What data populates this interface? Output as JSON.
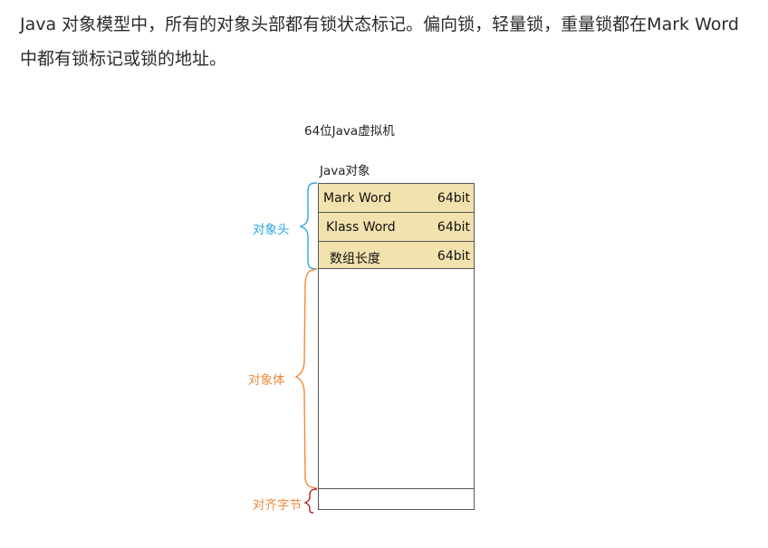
{
  "intro_text": "Java 对象模型中，所有的对象头部都有锁状态标记。偏向锁，轻量锁，重量锁都在Mark Word中都有锁标记或锁的地址。",
  "diagram": {
    "title": "64位Java虚拟机",
    "object_label": "Java对象",
    "header_rows": [
      {
        "name": "Mark Word",
        "bits": "64bit"
      },
      {
        "name": "Klass Word",
        "bits": "64bit"
      },
      {
        "name": "数组长度",
        "bits": "64bit"
      }
    ],
    "regions": {
      "header": {
        "label": "对象头",
        "color": "#29a7e0"
      },
      "body": {
        "label": "对象体",
        "color": "#f08a3c"
      },
      "padding": {
        "label": "对齐字节",
        "color": "#f08a3c",
        "brace_color": "#b22222"
      }
    }
  }
}
